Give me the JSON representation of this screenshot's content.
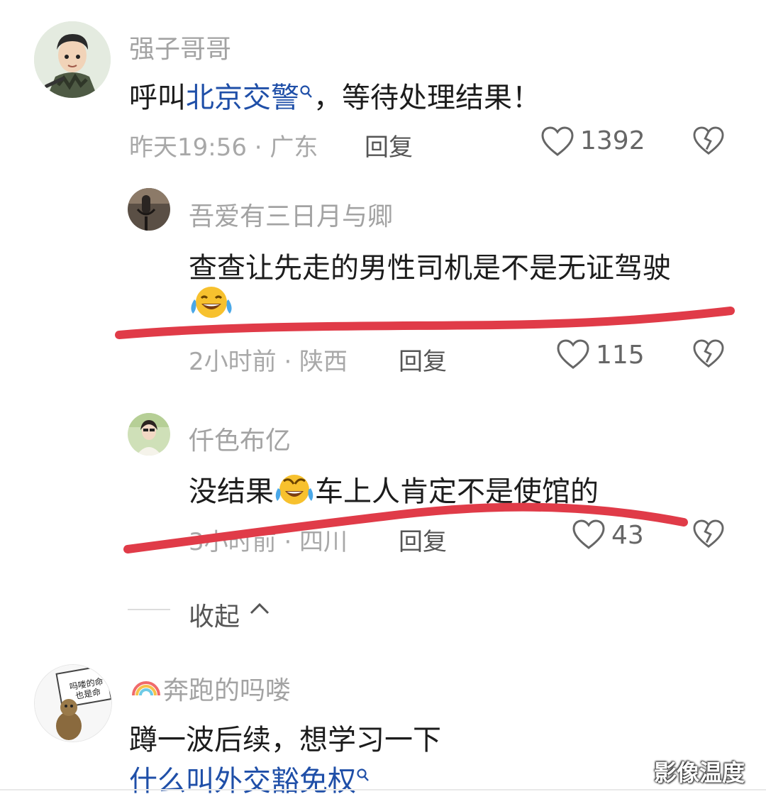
{
  "comments": [
    {
      "username": "强子哥哥",
      "text_prefix": "呼叫",
      "link_text": "北京交警",
      "text_suffix": "，等待处理结果！",
      "meta": "昨天19:56 · 广东",
      "reply_label": "回复",
      "likes": "1392"
    },
    {
      "username": "吾爱有三日月与卿",
      "text": "查查让先走的男性司机是不是无证驾驶",
      "emoji": "laugh-cry",
      "meta": "2小时前 · 陕西",
      "reply_label": "回复",
      "likes": "115"
    },
    {
      "username": "仟色布亿",
      "text_prefix": "没结果",
      "emoji": "laugh-cry",
      "text_suffix": "车上人肯定不是使馆的",
      "meta": "3小时前 · 四川",
      "reply_label": "回复",
      "likes": "43"
    },
    {
      "username": "奔跑的吗喽",
      "username_emoji": "rainbow",
      "text": "蹲一波后续，想学习一下",
      "link_text": "什么叫外交豁免权",
      "avatar_sign": [
        "吗喽的命",
        "也是命"
      ]
    }
  ],
  "collapse_label": "收起",
  "watermark": "影像温度",
  "colors": {
    "link": "#1f4fa8",
    "underline_mark": "#e03b48",
    "meta": "#a8a8a8"
  },
  "icons": [
    "search-icon",
    "heart-icon",
    "broken-heart-icon",
    "chevron-up-icon",
    "laugh-cry-emoji",
    "rainbow-emoji"
  ]
}
